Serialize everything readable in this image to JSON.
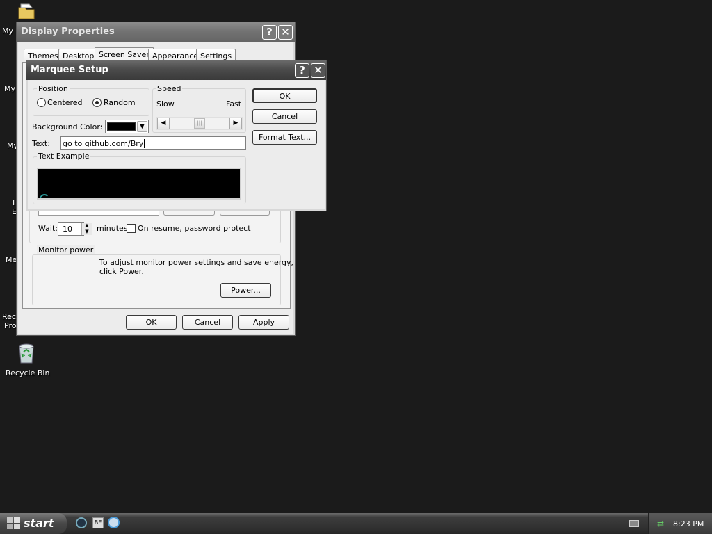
{
  "desktop": {
    "icons": [
      {
        "label": "My I",
        "icon": "my-documents-icon"
      },
      {
        "label": "My",
        "icon": "my-computer-icon"
      },
      {
        "label": "My",
        "icon": "my-network-icon"
      },
      {
        "label": "I",
        "icon": "internet-icon"
      },
      {
        "label": "E",
        "icon": "internet-icon"
      },
      {
        "label": "Me",
        "icon": "media-player-icon"
      },
      {
        "label": "Rec",
        "icon": "recorder-icon"
      },
      {
        "label": "Pro",
        "icon": "recorder-icon"
      }
    ],
    "recycle_bin": "Recycle Bin"
  },
  "display_properties": {
    "title": "Display Properties",
    "help_glyph": "?",
    "close_glyph": "✕",
    "tabs": [
      {
        "label": "Themes"
      },
      {
        "label": "Desktop"
      },
      {
        "label": "Screen Saver",
        "active": true
      },
      {
        "label": "Appearance"
      },
      {
        "label": "Settings"
      }
    ],
    "wait_label": "Wait:",
    "wait_value": "10",
    "minutes_label": "minutes",
    "password_protect_label": "On resume, password protect",
    "password_protect_checked": false,
    "monitor_power": {
      "title": "Monitor power",
      "line1": "To adjust monitor power settings and save energy,",
      "line2": "click Power.",
      "power_button": "Power..."
    },
    "buttons": {
      "ok": "OK",
      "cancel": "Cancel",
      "apply": "Apply"
    }
  },
  "marquee_setup": {
    "title": "Marquee Setup",
    "help_glyph": "?",
    "close_glyph": "✕",
    "position": {
      "title": "Position",
      "centered_label": "Centered",
      "random_label": "Random",
      "selected": "Random"
    },
    "speed": {
      "title": "Speed",
      "slow_label": "Slow",
      "fast_label": "Fast",
      "level": 0.5
    },
    "background_color": {
      "label": "Background Color:",
      "value": "#000000"
    },
    "text_field": {
      "label": "Text:",
      "value": "go to github.com/Bry"
    },
    "text_example_title": "Text Example",
    "buttons": {
      "ok": "OK",
      "cancel": "Cancel",
      "format_text": "Format Text..."
    }
  },
  "taskbar": {
    "start_label": "start",
    "quick_launch": [
      "ie-icon",
      "media-icon",
      "browser-icon"
    ],
    "clock": "8:23 PM"
  }
}
